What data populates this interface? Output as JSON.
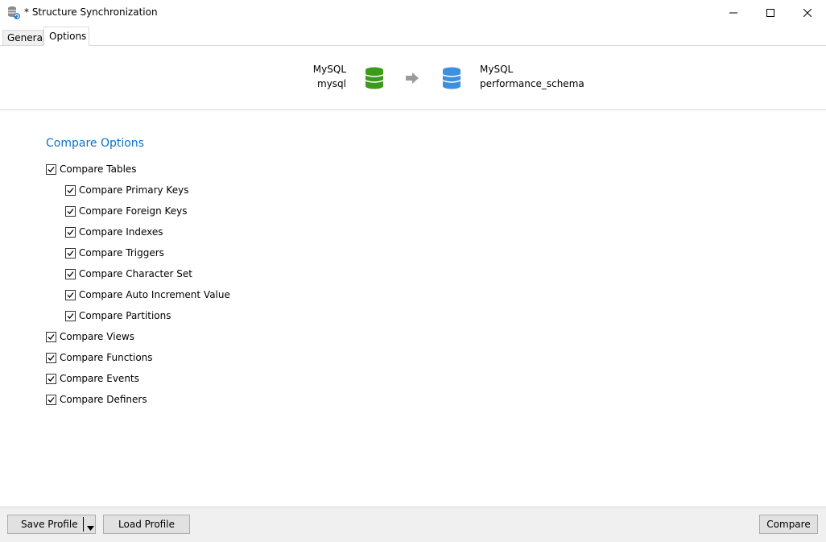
{
  "window": {
    "title": "* Structure Synchronization",
    "minimize_icon": "minimize-icon",
    "maximize_icon": "maximize-icon",
    "close_icon": "close-icon"
  },
  "tabs": [
    {
      "label": "General",
      "active": false
    },
    {
      "label": "Options",
      "active": true
    }
  ],
  "connection": {
    "source": {
      "type": "MySQL",
      "name": "mysql",
      "icon": "database-icon",
      "color": "#3c9a1c"
    },
    "target": {
      "type": "MySQL",
      "name": "performance_schema",
      "icon": "database-icon",
      "color": "#3d8fe0"
    },
    "arrow_icon": "arrow-right-icon"
  },
  "compare_options": {
    "title": "Compare Options",
    "title_color": "#0d72c7",
    "tables": {
      "label": "Compare Tables",
      "checked": true
    },
    "table_children": [
      {
        "label": "Compare Primary Keys",
        "checked": true
      },
      {
        "label": "Compare Foreign Keys",
        "checked": true
      },
      {
        "label": "Compare Indexes",
        "checked": true
      },
      {
        "label": "Compare Triggers",
        "checked": true
      },
      {
        "label": "Compare Character Set",
        "checked": true
      },
      {
        "label": "Compare Auto Increment Value",
        "checked": true
      },
      {
        "label": "Compare Partitions",
        "checked": true
      }
    ],
    "others": [
      {
        "label": "Compare Views",
        "checked": true
      },
      {
        "label": "Compare Functions",
        "checked": true
      },
      {
        "label": "Compare Events",
        "checked": true
      },
      {
        "label": "Compare Definers",
        "checked": true
      }
    ]
  },
  "footer": {
    "save_profile": "Save Profile",
    "load_profile": "Load Profile",
    "compare": "Compare"
  }
}
